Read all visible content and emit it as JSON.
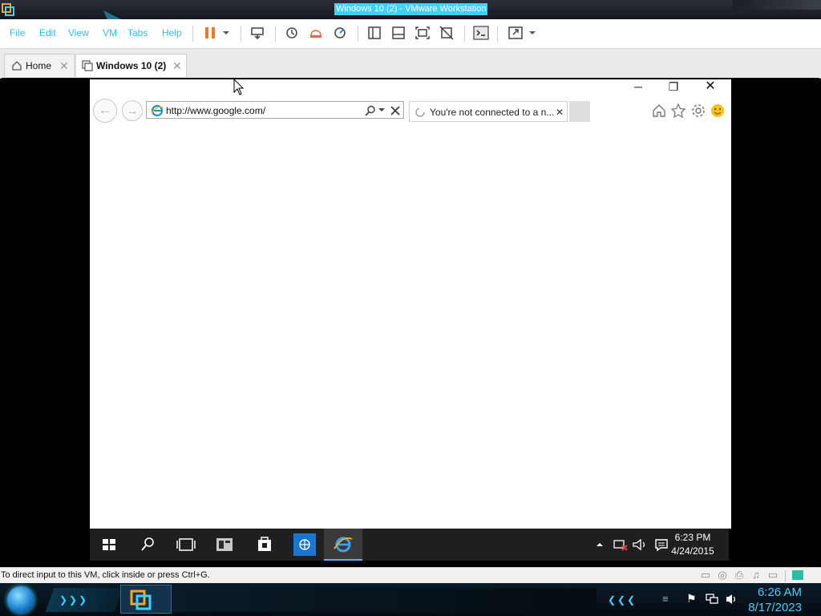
{
  "host": {
    "title": "Windows 10 (2) - VMware Workstation",
    "menu": [
      "File",
      "Edit",
      "View",
      "VM",
      "Tabs",
      "Help"
    ],
    "tabs": [
      {
        "label": "Home"
      },
      {
        "label": "Windows 10 (2)"
      }
    ],
    "status_text": "To direct input to this VM, click inside or press Ctrl+G.",
    "clock": {
      "time": "6:26 AM",
      "date": "8/17/2023"
    },
    "accent_color": "#3fd0ff"
  },
  "browser": {
    "address": "http://www.google.com/",
    "tab_title": "You're not connected to a n..."
  },
  "guest_taskbar": {
    "time": "6:23 PM",
    "date": "4/24/2015"
  }
}
